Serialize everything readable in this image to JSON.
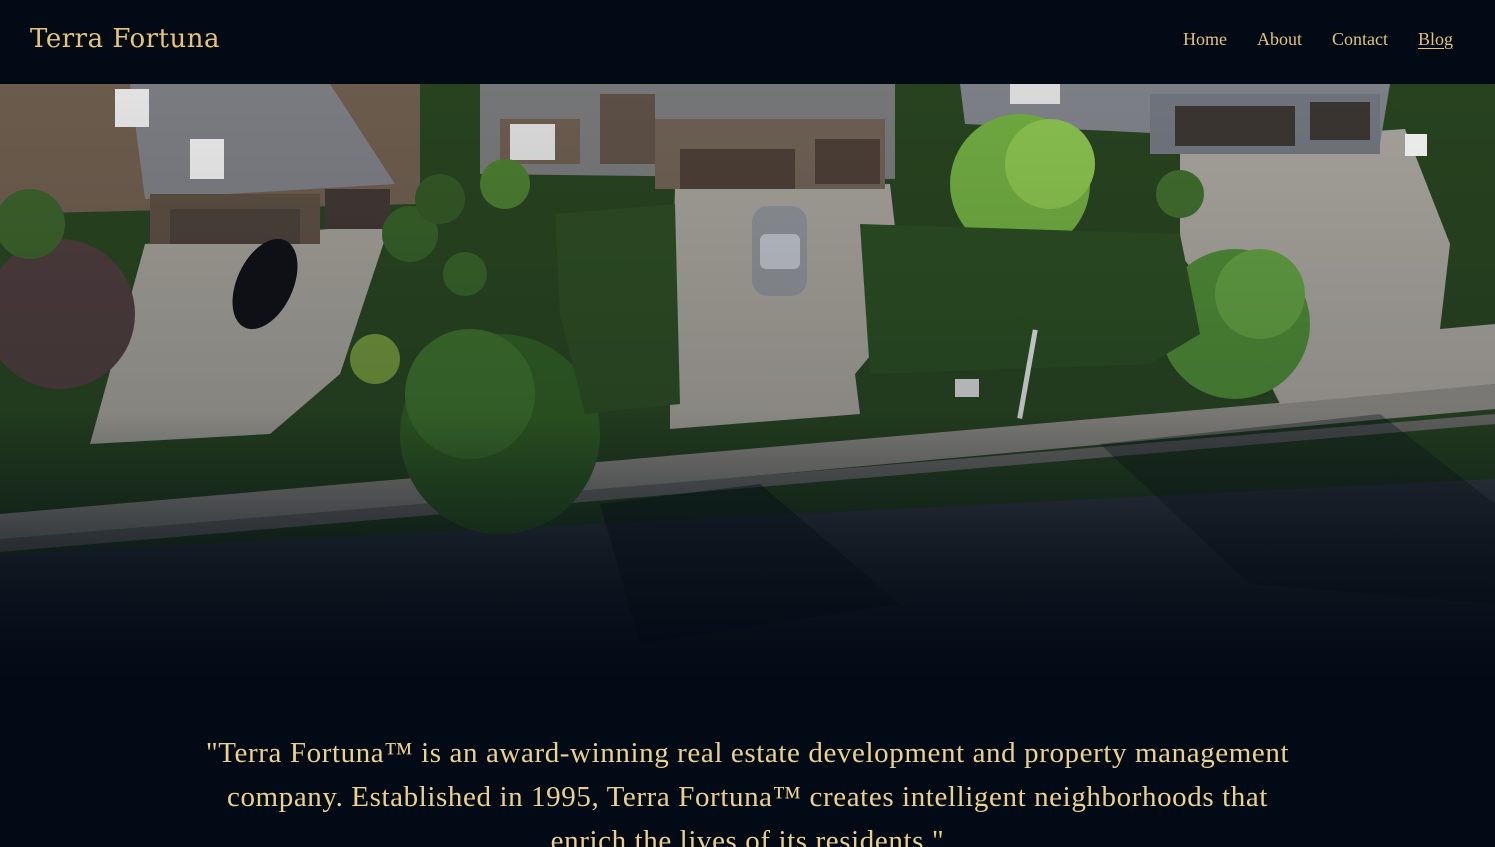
{
  "header": {
    "brand": "Terra Fortuna",
    "nav": [
      {
        "label": "Home",
        "active": false
      },
      {
        "label": "About",
        "active": false
      },
      {
        "label": "Contact",
        "active": false
      },
      {
        "label": "Blog",
        "active": true
      }
    ]
  },
  "hero": {
    "image_description_icon": "aerial-neighborhood-photo"
  },
  "intro": {
    "quote": "\"Terra Fortuna™ is an award-winning real estate development and property management company. Established in 1995, Terra Fortuna™ creates intelligent neighborhoods that enrich the lives of its residents.\""
  },
  "colors": {
    "background": "#020b15",
    "accent_gold": "#e7c476",
    "text_gold": "#ecd08f"
  }
}
